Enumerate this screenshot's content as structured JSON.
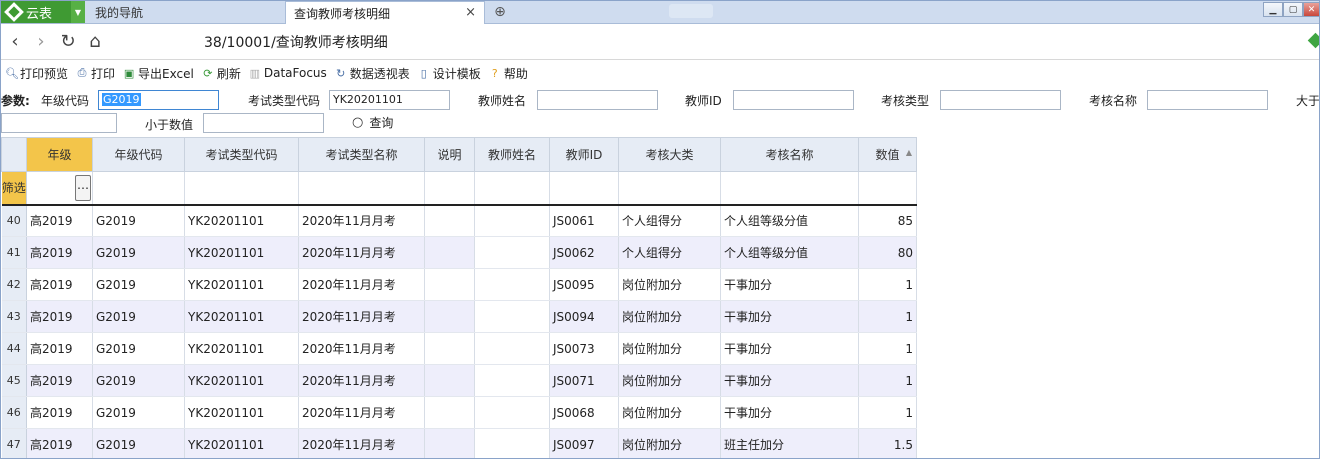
{
  "window": {
    "brand": "云表",
    "tabs": [
      {
        "label": "我的导航"
      },
      {
        "label": "查询教师考核明细"
      }
    ],
    "address": "38/10001/查询教师考核明细"
  },
  "toolbar": {
    "print_preview": "打印预览",
    "print": "打印",
    "export_excel": "导出Excel",
    "refresh": "刷新",
    "datafocus": "DataFocus",
    "pivot": "数据透视表",
    "design_template": "设计模板",
    "help": "帮助"
  },
  "params": {
    "title": "参数:",
    "grade_code_label": "年级代码",
    "grade_code_value": "G2019",
    "exam_type_code_label": "考试类型代码",
    "exam_type_code_value": "YK20201101",
    "teacher_name_label": "教师姓名",
    "teacher_id_label": "教师ID",
    "assess_type_label": "考核类型",
    "assess_name_label": "考核名称",
    "greater_label": "大于",
    "less_label": "小于数值",
    "query_label": "查询"
  },
  "grid": {
    "columns": [
      "年级",
      "年级代码",
      "考试类型代码",
      "考试类型名称",
      "说明",
      "教师姓名",
      "教师ID",
      "考核大类",
      "考核名称",
      "数值"
    ],
    "filter_label": "筛选",
    "rows": [
      {
        "n": "40",
        "grade": "高2019",
        "code": "G2019",
        "exam_code": "YK20201101",
        "exam_name": "2020年11月月考",
        "note": "",
        "teacher": "",
        "tid": "JS0061",
        "cat": "个人组得分",
        "name": "个人组等级分值",
        "val": "85"
      },
      {
        "n": "41",
        "grade": "高2019",
        "code": "G2019",
        "exam_code": "YK20201101",
        "exam_name": "2020年11月月考",
        "note": "",
        "teacher": "",
        "tid": "JS0062",
        "cat": "个人组得分",
        "name": "个人组等级分值",
        "val": "80"
      },
      {
        "n": "42",
        "grade": "高2019",
        "code": "G2019",
        "exam_code": "YK20201101",
        "exam_name": "2020年11月月考",
        "note": "",
        "teacher": "",
        "tid": "JS0095",
        "cat": "岗位附加分",
        "name": "干事加分",
        "val": "1"
      },
      {
        "n": "43",
        "grade": "高2019",
        "code": "G2019",
        "exam_code": "YK20201101",
        "exam_name": "2020年11月月考",
        "note": "",
        "teacher": "",
        "tid": "JS0094",
        "cat": "岗位附加分",
        "name": "干事加分",
        "val": "1"
      },
      {
        "n": "44",
        "grade": "高2019",
        "code": "G2019",
        "exam_code": "YK20201101",
        "exam_name": "2020年11月月考",
        "note": "",
        "teacher": "",
        "tid": "JS0073",
        "cat": "岗位附加分",
        "name": "干事加分",
        "val": "1"
      },
      {
        "n": "45",
        "grade": "高2019",
        "code": "G2019",
        "exam_code": "YK20201101",
        "exam_name": "2020年11月月考",
        "note": "",
        "teacher": "",
        "tid": "JS0071",
        "cat": "岗位附加分",
        "name": "干事加分",
        "val": "1"
      },
      {
        "n": "46",
        "grade": "高2019",
        "code": "G2019",
        "exam_code": "YK20201101",
        "exam_name": "2020年11月月考",
        "note": "",
        "teacher": "",
        "tid": "JS0068",
        "cat": "岗位附加分",
        "name": "干事加分",
        "val": "1"
      },
      {
        "n": "47",
        "grade": "高2019",
        "code": "G2019",
        "exam_code": "YK20201101",
        "exam_name": "2020年11月月考",
        "note": "",
        "teacher": "",
        "tid": "JS0097",
        "cat": "岗位附加分",
        "name": "班主任加分",
        "val": "1.5"
      }
    ]
  }
}
